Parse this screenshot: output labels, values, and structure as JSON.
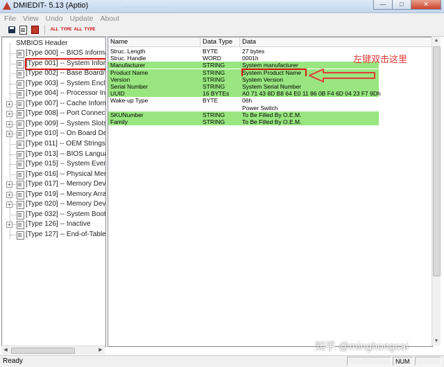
{
  "window": {
    "title": "DMIEDIT- 5.13 (Aptio)",
    "faded_title": "........  ............",
    "icon": "app-icon",
    "buttons": {
      "minimize": "—",
      "maximize": "□",
      "close": "✕"
    }
  },
  "menu": [
    "File",
    "View",
    "Undo",
    "Update",
    "About"
  ],
  "toolbar": {
    "items": [
      {
        "name": "save-icon",
        "label": ""
      },
      {
        "name": "copy-icon",
        "label": ""
      },
      {
        "name": "delete-icon",
        "label": ""
      },
      {
        "name": "all-1-icon",
        "label": "ALL"
      },
      {
        "name": "type-1-icon",
        "label": "TYPE"
      },
      {
        "name": "all-2-icon",
        "label": "ALL"
      },
      {
        "name": "type-2-icon",
        "label": "TYPE"
      }
    ]
  },
  "tree": {
    "root": "SMBIOS Header",
    "items": [
      {
        "label": "[Type 000] -- BIOS Informa",
        "expander": ""
      },
      {
        "label": "[Type 001] -- System Inform",
        "expander": "",
        "selected": true
      },
      {
        "label": "[Type 002] -- Base Board/M",
        "expander": ""
      },
      {
        "label": "[Type 003] -- System Enclos",
        "expander": ""
      },
      {
        "label": "[Type 004] -- Processor Info",
        "expander": ""
      },
      {
        "label": "[Type 007] -- Cache Inform",
        "expander": "+"
      },
      {
        "label": "[Type 008] -- Port Connecto",
        "expander": "+"
      },
      {
        "label": "[Type 009] -- System Slots",
        "expander": "+"
      },
      {
        "label": "[Type 010] -- On Board Dev",
        "expander": "+"
      },
      {
        "label": "[Type 011] -- OEM Strings",
        "expander": ""
      },
      {
        "label": "[Type 013] -- BIOS Languag",
        "expander": ""
      },
      {
        "label": "[Type 015] -- System Event",
        "expander": ""
      },
      {
        "label": "[Type 016] -- Physical Mem",
        "expander": ""
      },
      {
        "label": "[Type 017] -- Memory Devi",
        "expander": "+"
      },
      {
        "label": "[Type 019] -- Memory Arra",
        "expander": "+"
      },
      {
        "label": "[Type 020] -- Memory Devi",
        "expander": "+"
      },
      {
        "label": "[Type 032] -- System Boot I",
        "expander": ""
      },
      {
        "label": "[Type 126] -- Inactive",
        "expander": "+"
      },
      {
        "label": "[Type 127] -- End-of-Table",
        "expander": ""
      }
    ]
  },
  "table": {
    "headers": [
      "Name",
      "Data Type",
      "Data"
    ],
    "rows": [
      {
        "name": "Struc. Length",
        "type": "BYTE",
        "data": "27 bytes",
        "green": false
      },
      {
        "name": "Struc. Handle",
        "type": "WORD",
        "data": "0001h",
        "green": false
      },
      {
        "name": "Manufacturer",
        "type": "STRING",
        "data": "System manufacturer",
        "green": true
      },
      {
        "name": "Product Name",
        "type": "STRING",
        "data": "System Product Name",
        "green": true,
        "boxed": true
      },
      {
        "name": "Version",
        "type": "STRING",
        "data": "System Version",
        "green": true
      },
      {
        "name": "Serial Number",
        "type": "STRING",
        "data": "System Serial Number",
        "green": true
      },
      {
        "name": "UUID",
        "type": "16 BYTEs",
        "data": "A0 71 43 8D B8 64 E0 11 86 0B F4 6D 04 23 F7 9Dh",
        "green": true
      },
      {
        "name": "Wake-up Type",
        "type": "BYTE",
        "data": "06h",
        "green": false
      },
      {
        "name": "",
        "type": "",
        "data": "Power Switch",
        "green": false
      },
      {
        "name": "SKUNumber",
        "type": "STRING",
        "data": "To Be Filled By O.E.M.",
        "green": true
      },
      {
        "name": "Family",
        "type": "STRING",
        "data": "To Be Filled By O.E.M.",
        "green": true
      }
    ]
  },
  "annotation": {
    "text": "左键双击这里",
    "color": "#e53935"
  },
  "status": {
    "text": "Ready",
    "num": "NUM"
  },
  "watermark": "知乎 @minghongcai",
  "colors": {
    "row_green": "#99e680",
    "highlight_red": "#e01010",
    "annotation_red": "#e53935"
  }
}
